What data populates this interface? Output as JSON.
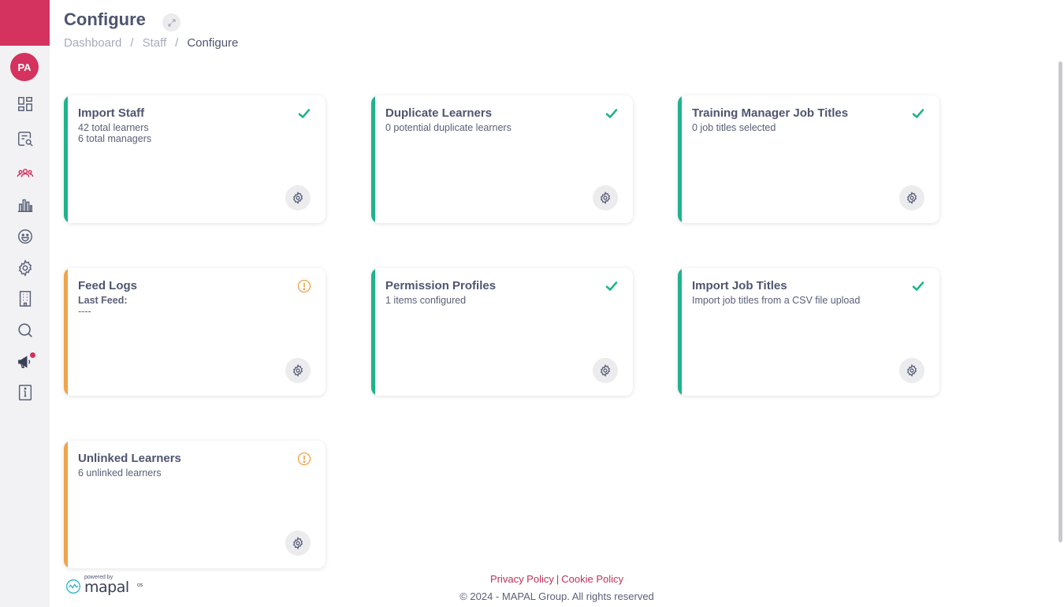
{
  "header": {
    "title": "Configure",
    "breadcrumb": [
      "Dashboard",
      "Staff",
      "Configure"
    ],
    "separator": "/"
  },
  "user": {
    "initials": "PA"
  },
  "colors": {
    "brand": "#d4335f",
    "success": "#1eb48c",
    "warning": "#f0a34a"
  },
  "sidebar": {
    "items": [
      {
        "icon": "dashboard-icon"
      },
      {
        "icon": "search-report-icon"
      },
      {
        "icon": "people-icon",
        "active": true
      },
      {
        "icon": "bar-chart-icon"
      },
      {
        "icon": "smiley-icon"
      },
      {
        "icon": "gear-icon"
      },
      {
        "icon": "building-icon"
      },
      {
        "icon": "search-icon"
      },
      {
        "icon": "megaphone-icon"
      },
      {
        "icon": "info-icon"
      }
    ]
  },
  "cards": [
    {
      "title": "Import Staff",
      "lines": [
        "42 total learners",
        "6 total managers"
      ],
      "status": "ok"
    },
    {
      "title": "Duplicate Learners",
      "lines": [
        "0 potential duplicate learners"
      ],
      "status": "ok"
    },
    {
      "title": "Training Manager Job Titles",
      "lines": [
        "0 job titles selected"
      ],
      "status": "ok"
    },
    {
      "title": "Feed Logs",
      "lines": [
        "Last Feed:",
        "----"
      ],
      "status": "warning"
    },
    {
      "title": "Permission Profiles",
      "lines": [
        "1 items configured"
      ],
      "status": "ok"
    },
    {
      "title": "Import Job Titles",
      "lines": [
        "Import job titles from a CSV file upload"
      ],
      "status": "ok"
    },
    {
      "title": "Unlinked Learners",
      "lines": [
        "6 unlinked learners"
      ],
      "status": "warning"
    }
  ],
  "footer": {
    "privacy": "Privacy Policy",
    "pipe": "|",
    "cookie": "Cookie Policy",
    "copyright": "© 2024 - MAPAL Group. All rights reserved",
    "powered_by": "powered by",
    "brand": "mapal",
    "brand_suffix": "os"
  }
}
